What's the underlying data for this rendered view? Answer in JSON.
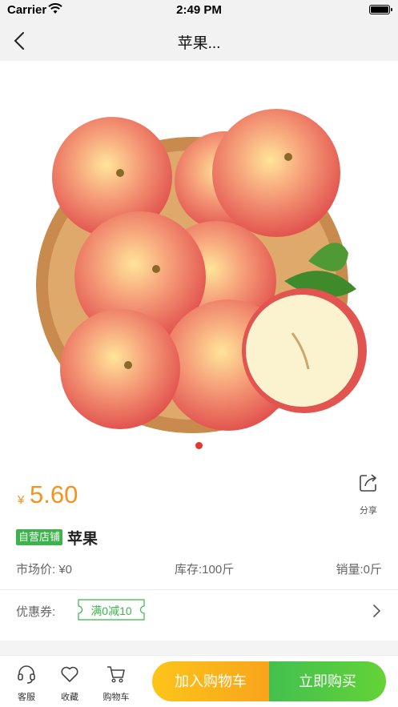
{
  "status_bar": {
    "carrier": "Carrier",
    "time": "2:49 PM"
  },
  "nav": {
    "title": "苹果...",
    "back_icon": "chevron-left-icon"
  },
  "gallery": {
    "image": "apples-in-wooden-bowl",
    "slides_total": 1,
    "active_slide": 1,
    "dot_color": "#e03a2f"
  },
  "product": {
    "currency": "¥",
    "price": "5.60",
    "badge": "自营店铺",
    "name": "苹果",
    "market_price": "市场价: ¥0",
    "stock": "库存:100斤",
    "sales": "销量:0斤",
    "share_label": "分享"
  },
  "coupon": {
    "label": "优惠券:",
    "ticket": "满0减10"
  },
  "bottom_bar": {
    "service_label": "客服",
    "favorite_label": "收藏",
    "cart_label": "购物车",
    "add_to_cart": "加入购物车",
    "buy_now": "立即购买"
  },
  "colors": {
    "accent_price": "#f7921e",
    "badge_green": "#3cb44b",
    "buy_green": "#4dc444",
    "cart_yellow": "#fbb41a"
  }
}
